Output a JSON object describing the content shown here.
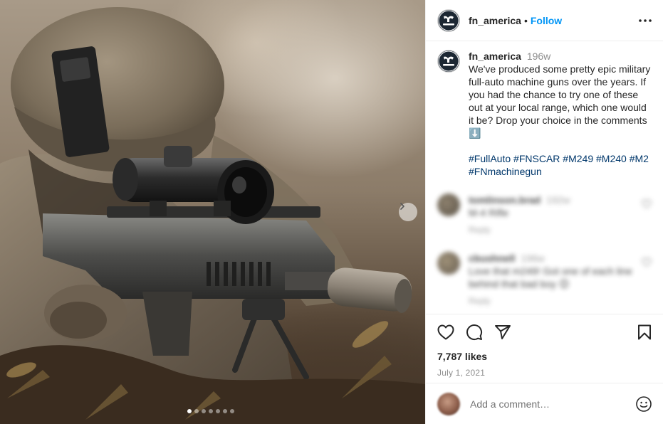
{
  "post": {
    "username": "fn_america",
    "separator": "•",
    "follow_label": "Follow",
    "avatar_text": "FIREARMS",
    "icons": {
      "more": "more-horizontal-icon",
      "next": "chevron-right-icon"
    },
    "carousel": {
      "count": 7,
      "active_index": 0
    }
  },
  "caption": {
    "username": "fn_america",
    "age": "196w",
    "text": "We've produced some pretty epic military full-auto machine guns over the years. If you had the chance to try one of these out at your local range, which one would it be? Drop your choice in the comments ⬇️",
    "hashtags": [
      "#FullAuto",
      "#FNSCAR",
      "#M249",
      "#M240",
      "#M2",
      "#FNmachinegun"
    ]
  },
  "comments": [
    {
      "username": "tomlinson.brad",
      "time": "192w",
      "text": "M-4 Rifle",
      "reply_label": "Reply"
    },
    {
      "username": "cbushnell",
      "time": "196w",
      "text": "Love that m249! Got one of each line behind that bad boy 😊",
      "reply_label": "Reply"
    }
  ],
  "actions": {
    "icons": [
      "heart-icon",
      "comment-icon",
      "share-icon",
      "bookmark-icon"
    ],
    "likes": "7,787 likes",
    "date": "July 1, 2021"
  },
  "add_comment": {
    "placeholder": "Add a comment…",
    "emoji_icon": "emoji-icon"
  },
  "colors": {
    "link": "#0095f6",
    "hashtag": "#00376b",
    "muted": "#8e8e8e",
    "text": "#262626",
    "divider": "#efefef"
  }
}
